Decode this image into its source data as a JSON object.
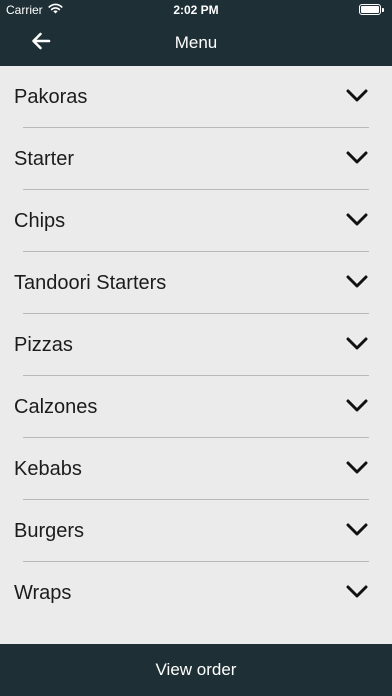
{
  "status_bar": {
    "carrier": "Carrier",
    "time": "2:02 PM",
    "wifi_icon": "wifi-icon",
    "battery_icon": "battery-icon",
    "battery_level": 1.0
  },
  "nav": {
    "back_icon": "arrow-left-icon",
    "title": "Menu"
  },
  "menu": {
    "items": [
      {
        "label": "Pakoras",
        "icon": "chevron-down-icon"
      },
      {
        "label": "Starter",
        "icon": "chevron-down-icon"
      },
      {
        "label": "Chips",
        "icon": "chevron-down-icon"
      },
      {
        "label": "Tandoori Starters",
        "icon": "chevron-down-icon"
      },
      {
        "label": "Pizzas",
        "icon": "chevron-down-icon"
      },
      {
        "label": "Calzones",
        "icon": "chevron-down-icon"
      },
      {
        "label": "Kebabs",
        "icon": "chevron-down-icon"
      },
      {
        "label": "Burgers",
        "icon": "chevron-down-icon"
      },
      {
        "label": "Wraps",
        "icon": "chevron-down-icon"
      }
    ]
  },
  "footer": {
    "view_order_label": "View order"
  },
  "colors": {
    "header_bg": "#1e2f35",
    "list_bg": "#ebebeb",
    "divider": "#b9b9b9",
    "text": "#1c1c1c"
  }
}
